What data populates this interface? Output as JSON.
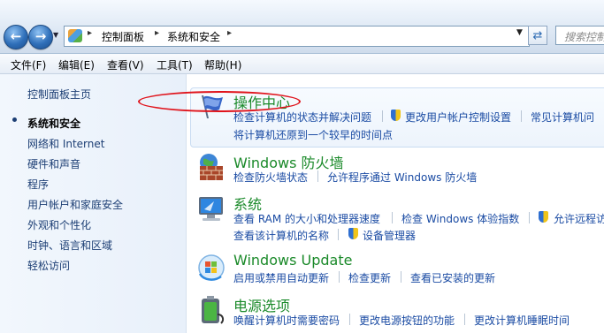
{
  "address_bar": {
    "breadcrumbs": [
      "控制面板",
      "系统和安全"
    ],
    "search_placeholder": "搜索控制面"
  },
  "menu": [
    "文件(F)",
    "编辑(E)",
    "查看(V)",
    "工具(T)",
    "帮助(H)"
  ],
  "sidebar": {
    "items": [
      {
        "label": "控制面板主页"
      },
      {
        "label": "系统和安全",
        "current": true
      },
      {
        "label": "网络和 Internet"
      },
      {
        "label": "硬件和声音"
      },
      {
        "label": "程序"
      },
      {
        "label": "用户帐户和家庭安全"
      },
      {
        "label": "外观和个性化"
      },
      {
        "label": "时钟、语言和区域"
      },
      {
        "label": "轻松访问"
      }
    ]
  },
  "categories": [
    {
      "title": "操作中心",
      "icon": "flag-icon",
      "links": [
        "检查计算机的状态并解决问题",
        "更改用户帐户控制设置",
        "常见计算机问",
        "将计算机还原到一个较早的时间点"
      ]
    },
    {
      "title": "Windows 防火墙",
      "icon": "firewall-icon",
      "links": [
        "检查防火墙状态",
        "允许程序通过 Windows 防火墙"
      ]
    },
    {
      "title": "系统",
      "icon": "computer-icon",
      "links": [
        "查看 RAM 的大小和处理器速度",
        "检查 Windows 体验指数",
        "允许远程访",
        "查看该计算机的名称",
        "设备管理器"
      ]
    },
    {
      "title": "Windows Update",
      "icon": "windows-update-icon",
      "links": [
        "启用或禁用自动更新",
        "检查更新",
        "查看已安装的更新"
      ]
    },
    {
      "title": "电源选项",
      "icon": "battery-plug-icon",
      "links": [
        "唤醒计算机时需要密码",
        "更改电源按钮的功能",
        "更改计算机睡眠时间"
      ]
    }
  ],
  "colors": {
    "title_green": "#1b8a2a",
    "link_blue": "#1a4ba3",
    "annotation_red": "#e0141c"
  }
}
